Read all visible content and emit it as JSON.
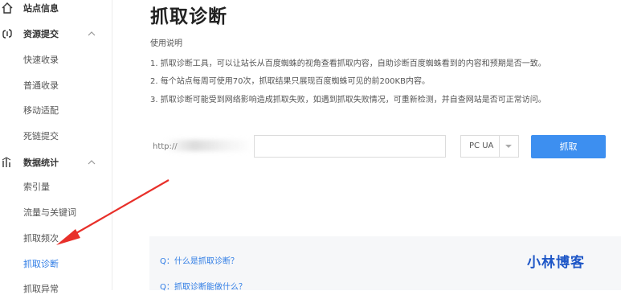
{
  "sidebar": {
    "site_info": {
      "label": "站点信息",
      "icon": "home-icon"
    },
    "resource_submit": {
      "label": "资源提交",
      "icon": "link-icon",
      "chevron": "chevron-up-icon",
      "items": [
        {
          "label": "快速收录"
        },
        {
          "label": "普通收录"
        },
        {
          "label": "移动适配"
        },
        {
          "label": "死链提交"
        }
      ]
    },
    "data_stats": {
      "label": "数据统计",
      "icon": "chart-icon",
      "chevron": "chevron-up-icon",
      "items": [
        {
          "label": "索引量"
        },
        {
          "label": "流量与关键词"
        },
        {
          "label": "抓取频次"
        },
        {
          "label": "抓取诊断"
        },
        {
          "label": "抓取异常"
        }
      ]
    }
  },
  "main": {
    "title": "抓取诊断",
    "usage_title": "使用说明",
    "usage_lines": [
      "1. 抓取诊断工具，可以让站长从百度蜘蛛的视角查看抓取内容，自助诊断百度蜘蛛看到的内容和预期是否一致。",
      "2. 每个站点每周可使用70次，抓取结果只展现百度蜘蛛可见的前200KB内容。",
      "3. 抓取诊断可能受到网络影响造成抓取失败，如遇到抓取失败情况，可重新检测，并自查网站是否可正常访问。"
    ],
    "url_prefix": "http://",
    "url_value": "",
    "ua_select": {
      "value": "PC UA"
    },
    "fetch_button": "抓取",
    "faq": [
      "Q：什么是抓取诊断？",
      "Q：抓取诊断能做什么？"
    ]
  },
  "watermark": "小林博客",
  "colors": {
    "accent": "#2d7be5",
    "button": "#3d8ff0",
    "arrow": "#e8302a"
  }
}
